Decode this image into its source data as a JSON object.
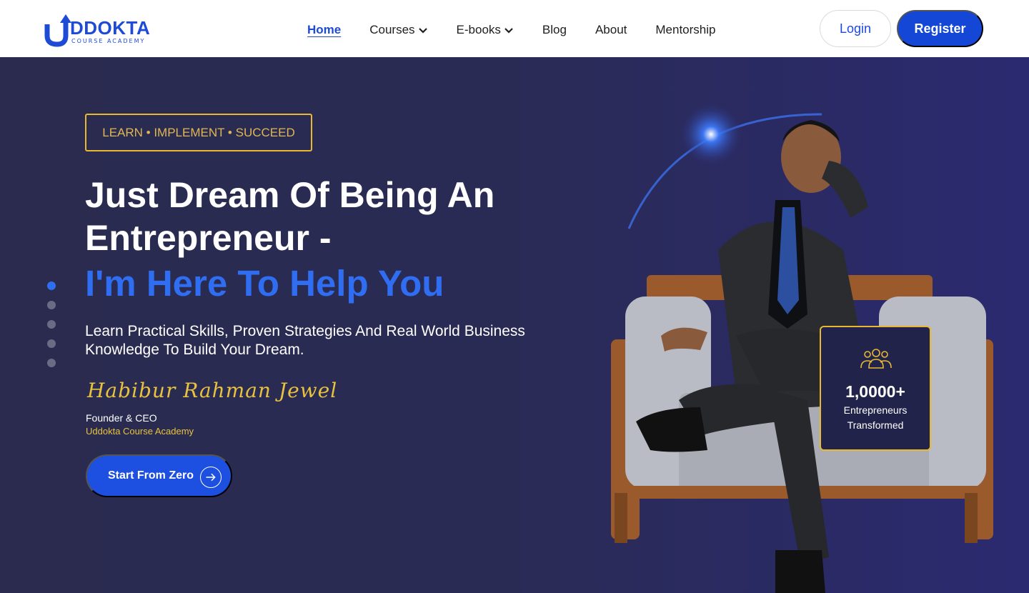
{
  "brand": {
    "name": "DDOKTA",
    "subtitle": "COURSE ACADEMY",
    "color": "#1d4bd6"
  },
  "nav": {
    "items": [
      {
        "label": "Home",
        "active": true
      },
      {
        "label": "Courses",
        "dropdown": true
      },
      {
        "label": "E-books",
        "dropdown": true
      },
      {
        "label": "Blog"
      },
      {
        "label": "About"
      },
      {
        "label": "Mentorship"
      }
    ],
    "login_label": "Login",
    "register_label": "Register"
  },
  "hero": {
    "tagline": "LEARN • IMPLEMENT • SUCCEED",
    "headline_line1": "Just Dream Of Being An",
    "headline_line2": "Entrepreneur -",
    "headline_accent": "I'm Here To Help You",
    "subtext": "Learn Practical Skills, Proven Strategies And Real World Business Knowledge To Build Your Dream.",
    "signature": "Habibur Rahman Jewel",
    "role": "Founder & CEO",
    "organization": "Uddokta Course Academy",
    "cta_label": "Start From Zero",
    "slides_total": 5,
    "active_slide": 1
  },
  "stat_card": {
    "icon": "people-group-icon",
    "number": "1,0000+",
    "label_line1": "Entrepreneurs",
    "label_line2": "Transformed"
  },
  "colors": {
    "accent_blue": "#2f6ef2",
    "gold": "#e8b833",
    "hero_bg": "#2a2b55"
  }
}
